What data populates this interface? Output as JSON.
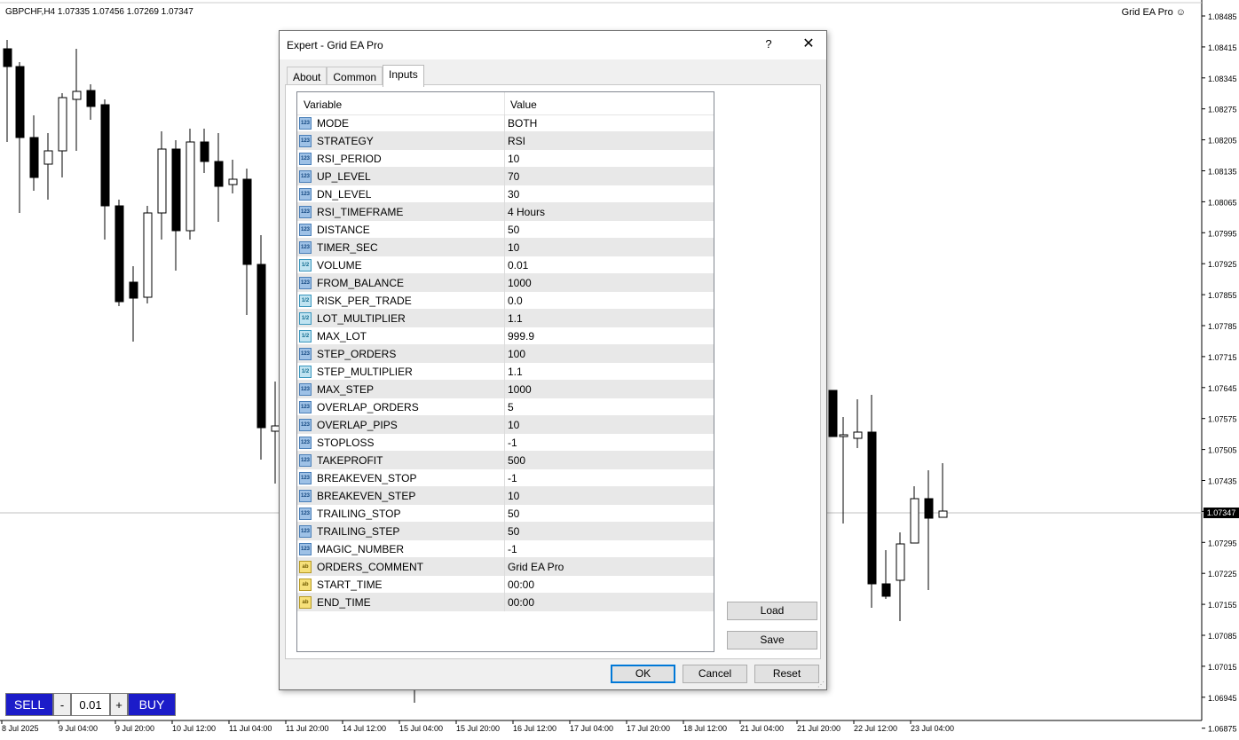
{
  "chart": {
    "title": "GBPCHF,H4  1.07335 1.07456 1.07269 1.07347",
    "ea_label": "Grid EA Pro",
    "current_price": "1.07347",
    "price_labels": [
      "1.08485",
      "1.08415",
      "1.08345",
      "1.08275",
      "1.08205",
      "1.08135",
      "1.08065",
      "1.07995",
      "1.07925",
      "1.07855",
      "1.07785",
      "1.07715",
      "1.07645",
      "1.07575",
      "1.07505",
      "1.07435",
      "1.07365",
      "1.07295",
      "1.07225",
      "1.07155",
      "1.07085",
      "1.07015",
      "1.06945",
      "1.06875"
    ],
    "time_labels": [
      "8 Jul 2025",
      "9 Jul 04:00",
      "9 Jul 20:00",
      "10 Jul 12:00",
      "11 Jul 04:00",
      "11 Jul 20:00",
      "14 Jul 12:00",
      "15 Jul 04:00",
      "15 Jul 20:00",
      "16 Jul 12:00",
      "17 Jul 04:00",
      "17 Jul 20:00",
      "18 Jul 12:00",
      "21 Jul 04:00",
      "21 Jul 20:00",
      "22 Jul 12:00",
      "23 Jul 04:00"
    ]
  },
  "trade_panel": {
    "sell_label": "SELL",
    "minus_label": "-",
    "lot_value": "0.01",
    "plus_label": "+",
    "buy_label": "BUY"
  },
  "dialog": {
    "title": "Expert - Grid EA Pro",
    "help_label": "?",
    "close_label": "✕",
    "tabs": [
      {
        "label": "About"
      },
      {
        "label": "Common"
      },
      {
        "label": "Inputs"
      }
    ],
    "grid": {
      "col_variable": "Variable",
      "col_value": "Value",
      "rows": [
        {
          "type": "int",
          "variable": "MODE",
          "value": "BOTH"
        },
        {
          "type": "int",
          "variable": "STRATEGY",
          "value": "RSI"
        },
        {
          "type": "int",
          "variable": "RSI_PERIOD",
          "value": "10"
        },
        {
          "type": "int",
          "variable": "UP_LEVEL",
          "value": "70"
        },
        {
          "type": "int",
          "variable": "DN_LEVEL",
          "value": "30"
        },
        {
          "type": "int",
          "variable": "RSI_TIMEFRAME",
          "value": "4 Hours"
        },
        {
          "type": "int",
          "variable": "DISTANCE",
          "value": "50"
        },
        {
          "type": "int",
          "variable": "TIMER_SEC",
          "value": "10"
        },
        {
          "type": "double",
          "variable": "VOLUME",
          "value": "0.01"
        },
        {
          "type": "int",
          "variable": "FROM_BALANCE",
          "value": "1000"
        },
        {
          "type": "double",
          "variable": "RISK_PER_TRADE",
          "value": "0.0"
        },
        {
          "type": "double",
          "variable": "LOT_MULTIPLIER",
          "value": "1.1"
        },
        {
          "type": "double",
          "variable": "MAX_LOT",
          "value": "999.9"
        },
        {
          "type": "int",
          "variable": "STEP_ORDERS",
          "value": "100"
        },
        {
          "type": "double",
          "variable": "STEP_MULTIPLIER",
          "value": "1.1"
        },
        {
          "type": "int",
          "variable": "MAX_STEP",
          "value": "1000"
        },
        {
          "type": "int",
          "variable": "OVERLAP_ORDERS",
          "value": "5"
        },
        {
          "type": "int",
          "variable": "OVERLAP_PIPS",
          "value": "10"
        },
        {
          "type": "int",
          "variable": "STOPLOSS",
          "value": "-1"
        },
        {
          "type": "int",
          "variable": "TAKEPROFIT",
          "value": "500"
        },
        {
          "type": "int",
          "variable": "BREAKEVEN_STOP",
          "value": "-1"
        },
        {
          "type": "int",
          "variable": "BREAKEVEN_STEP",
          "value": "10"
        },
        {
          "type": "int",
          "variable": "TRAILING_STOP",
          "value": "50"
        },
        {
          "type": "int",
          "variable": "TRAILING_STEP",
          "value": "50"
        },
        {
          "type": "int",
          "variable": "MAGIC_NUMBER",
          "value": "-1"
        },
        {
          "type": "string",
          "variable": "ORDERS_COMMENT",
          "value": "Grid EA Pro"
        },
        {
          "type": "string",
          "variable": "START_TIME",
          "value": "00:00"
        },
        {
          "type": "string",
          "variable": "END_TIME",
          "value": "00:00"
        }
      ]
    },
    "icons": {
      "int": "123",
      "double": "1/2",
      "string": "ab"
    },
    "load_label": "Load",
    "save_label": "Save",
    "ok_label": "OK",
    "cancel_label": "Cancel",
    "reset_label": "Reset"
  }
}
